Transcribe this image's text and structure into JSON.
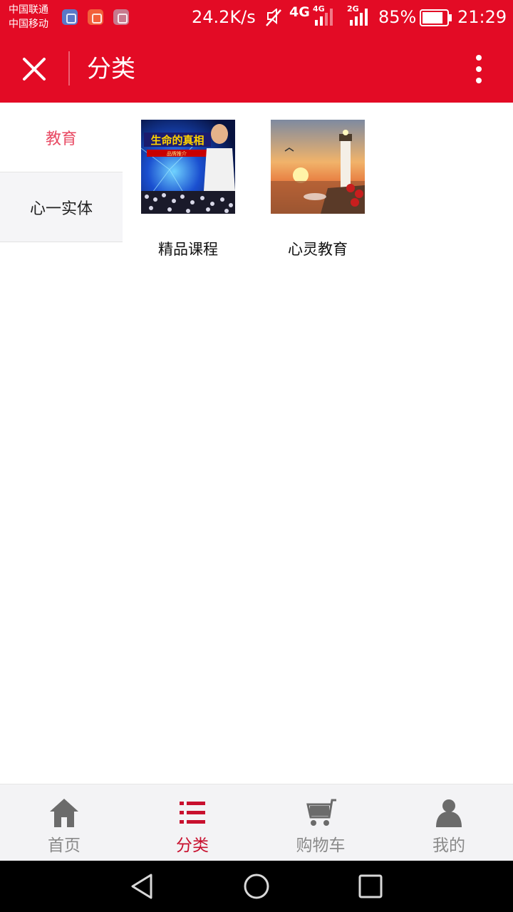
{
  "status_bar": {
    "carrier_1": "中国联通",
    "carrier_2": "中国移动",
    "net_speed": "24.2K/s",
    "network_1": "4G",
    "network_1_small": "4G",
    "network_2_small": "2G",
    "battery": "85%",
    "battery_level": 0.85,
    "time": "21:29",
    "icons": [
      "location-app-icon",
      "message-app-icon",
      "gallery-app-icon",
      "mute-icon",
      "signal-icon",
      "battery-icon"
    ]
  },
  "header": {
    "title": "分类",
    "close_icon": "close-icon",
    "more_icon": "more-vertical-icon"
  },
  "sidebar": {
    "items": [
      {
        "label": "教育",
        "selected": true
      },
      {
        "label": "心一实体",
        "selected": false
      }
    ]
  },
  "categories": [
    {
      "name": "精品课程",
      "thumb_caption": "生命的真相",
      "thumb_subcaption": "品牌推介"
    },
    {
      "name": "心灵教育"
    }
  ],
  "tab_bar": {
    "items": [
      {
        "label": "首页",
        "icon": "home-icon",
        "active": false
      },
      {
        "label": "分类",
        "icon": "list-icon",
        "active": true
      },
      {
        "label": "购物车",
        "icon": "cart-icon",
        "active": false
      },
      {
        "label": "我的",
        "icon": "profile-icon",
        "active": false
      }
    ]
  },
  "nav_bar": {
    "icons": [
      "back-icon",
      "home-circle-icon",
      "recents-icon"
    ]
  },
  "colors": {
    "brand_red": "#e30b25",
    "active_sidebar_text": "#e84a63",
    "active_tab": "#c8102e",
    "inactive_tab": "#8a8a8a"
  }
}
